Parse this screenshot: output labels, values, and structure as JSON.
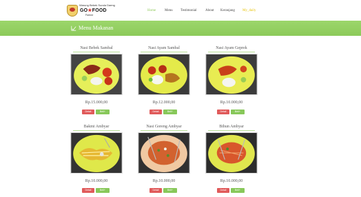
{
  "logo": {
    "top_text": "Warung Bebek Sunda Daeng",
    "brand_prefix": "GO",
    "brand_mid": "★",
    "brand_suffix": "FOOD",
    "sub_text": "Partner"
  },
  "nav": {
    "items": [
      {
        "label": "Home",
        "state": "active"
      },
      {
        "label": "Menu"
      },
      {
        "label": "Testimonial"
      },
      {
        "label": "About"
      },
      {
        "label": "Keranjang"
      },
      {
        "label": "My_daily",
        "state": "highlight"
      }
    ]
  },
  "banner": {
    "title": "Menu Makanan",
    "icon": "checkmark-icon"
  },
  "colors": {
    "accent_green": "#8cca5a",
    "detail_red": "#e05a5a",
    "buy_green": "#88c85a",
    "cart_yellow": "#e6c200"
  },
  "menu": [
    {
      "name": "Nasi Bebek Sambal",
      "price": "Rp.15.000,00",
      "detail_label": "Detail",
      "buy_label": "Beli+",
      "plate": "bebek"
    },
    {
      "name": "Nasi Ayam Sambal",
      "price": "Rp.12.000,00",
      "detail_label": "Detail",
      "buy_label": "Beli+",
      "plate": "ayam"
    },
    {
      "name": "Nasi Ayam Geprek",
      "price": "Rp.10.000,00",
      "detail_label": "Detail",
      "buy_label": "Beli+",
      "plate": "geprek"
    },
    {
      "name": "Bakmi Ambyar",
      "price": "Rp.10.000,00",
      "detail_label": "Detail",
      "buy_label": "Beli+",
      "plate": "bakmi"
    },
    {
      "name": "Nasi Goreng Ambyar",
      "price": "Rp.10.000,00",
      "detail_label": "Detail",
      "buy_label": "Beli+",
      "plate": "nasgor"
    },
    {
      "name": "Bihun Ambyar",
      "price": "Rp.10.000,00",
      "detail_label": "Detail",
      "buy_label": "Beli+",
      "plate": "bihun"
    }
  ]
}
